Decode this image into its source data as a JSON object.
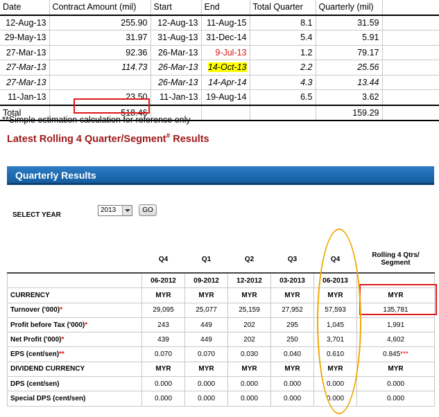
{
  "contracts": {
    "headers": [
      "Date",
      "Contract Amount (mil)",
      "Start",
      "End",
      "Total Quarter",
      "Quarterly (mil)"
    ],
    "rows": [
      {
        "date": "12-Aug-13",
        "amount": "255.90",
        "start": "12-Aug-13",
        "end": "11-Aug-15",
        "quarters": "8.1",
        "quarterly": "31.59"
      },
      {
        "date": "29-May-13",
        "amount": "31.97",
        "start": "31-Aug-13",
        "end": "31-Dec-14",
        "quarters": "5.4",
        "quarterly": "5.91"
      },
      {
        "date": "27-Mar-13",
        "amount": "92.36",
        "start": "26-Mar-13",
        "end": "9-Jul-13",
        "quarters": "1.2",
        "quarterly": "79.17"
      },
      {
        "date": "27-Mar-13",
        "amount": "114.73",
        "start": "26-Mar-13",
        "end": "14-Oct-13",
        "quarters": "2.2",
        "quarterly": "25.56"
      },
      {
        "date": "27-Mar-13",
        "amount": "",
        "start": "26-Mar-13",
        "end": "14-Apr-14",
        "quarters": "4.3",
        "quarterly": "13.44"
      },
      {
        "date": "11-Jan-13",
        "amount": "23.50",
        "start": "11-Jan-13",
        "end": "19-Aug-14",
        "quarters": "6.5",
        "quarterly": "3.62"
      }
    ],
    "total_label": "Total",
    "total_amount": "518.46",
    "total_quarterly": "159.29",
    "footnote": "**Simple estimation calculation for reference only",
    "highlight_red": "#e01010",
    "highlight_yellow": "#ffff00"
  },
  "rolling_title": {
    "text": "Latest Rolling 4 Quarter/Segment",
    "sup": "#",
    "suffix": " Results"
  },
  "banner": {
    "title": "Quarterly Results",
    "color": "#1f6db3"
  },
  "select_year": {
    "label": "SELECT YEAR",
    "value": "2013",
    "go_label": "GO"
  },
  "results": {
    "quarters": [
      "Q4",
      "Q1",
      "Q2",
      "Q3",
      "Q4"
    ],
    "rolling_header": "Rolling 4 Qtrs/ Segment",
    "dates": [
      "06-2012",
      "09-2012",
      "12-2012",
      "03-2013",
      "06-2013"
    ],
    "rows": [
      {
        "label": "CURRENCY",
        "ast": "",
        "values": [
          "MYR",
          "MYR",
          "MYR",
          "MYR",
          "MYR"
        ],
        "rolling": "MYR",
        "rolling_ast": ""
      },
      {
        "label": "Turnover ('000)",
        "ast": "*",
        "values": [
          "29,095",
          "25,077",
          "25,159",
          "27,952",
          "57,593"
        ],
        "rolling": "135,781",
        "rolling_ast": ""
      },
      {
        "label": "Profit before Tax ('000)",
        "ast": "*",
        "values": [
          "243",
          "449",
          "202",
          "295",
          "1,045"
        ],
        "rolling": "1,991",
        "rolling_ast": ""
      },
      {
        "label": "Net Profit ('000)",
        "ast": "*",
        "values": [
          "439",
          "449",
          "202",
          "250",
          "3,701"
        ],
        "rolling": "4,602",
        "rolling_ast": ""
      },
      {
        "label": "EPS (cent/sen)",
        "ast": "**",
        "values": [
          "0.070",
          "0.070",
          "0.030",
          "0.040",
          "0.610"
        ],
        "rolling": "0.845",
        "rolling_ast": "***"
      },
      {
        "label": "DIVIDEND CURRENCY",
        "ast": "",
        "values": [
          "MYR",
          "MYR",
          "MYR",
          "MYR",
          "MYR"
        ],
        "rolling": "MYR",
        "rolling_ast": ""
      },
      {
        "label": "DPS (cent/sen)",
        "ast": "",
        "values": [
          "0.000",
          "0.000",
          "0.000",
          "0.000",
          "0.000"
        ],
        "rolling": "0.000",
        "rolling_ast": ""
      },
      {
        "label": "Special DPS (cent/sen)",
        "ast": "",
        "values": [
          "0.000",
          "0.000",
          "0.000",
          "0.000",
          "0.000"
        ],
        "rolling": "0.000",
        "rolling_ast": ""
      }
    ],
    "annotation_colors": {
      "box": "#e01818",
      "ellipse": "#f0a800"
    }
  }
}
